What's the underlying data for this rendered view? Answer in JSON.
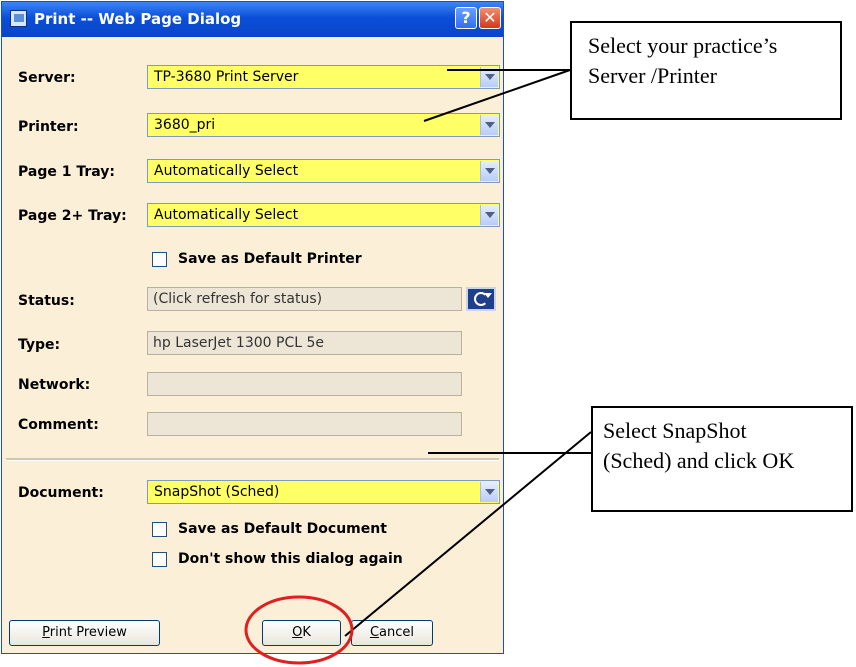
{
  "dialog": {
    "title": "Print -- Web Page Dialog",
    "help_label": "?",
    "close_label": "✕",
    "server": {
      "label": "Server:",
      "value": "TP-3680 Print Server"
    },
    "printer": {
      "label": "Printer:",
      "value": "3680_pri"
    },
    "page1_tray": {
      "label": "Page 1 Tray:",
      "value": "Automatically Select"
    },
    "page2_tray": {
      "label": "Page 2+ Tray:",
      "value": "Automatically Select"
    },
    "save_default_printer": {
      "label": "Save as Default Printer",
      "checked": false
    },
    "status": {
      "label": "Status:",
      "value": "(Click refresh for status)"
    },
    "type": {
      "label": "Type:",
      "value": "hp LaserJet 1300 PCL 5e"
    },
    "network": {
      "label": "Network:",
      "value": ""
    },
    "comment": {
      "label": "Comment:",
      "value": ""
    },
    "document": {
      "label": "Document:",
      "value": "SnapShot (Sched)"
    },
    "save_default_document": {
      "label": "Save as Default Document",
      "checked": false
    },
    "dont_show_again": {
      "label": "Don't show this dialog again",
      "checked": false
    },
    "buttons": {
      "print_preview": {
        "prefix": "",
        "mnemonic": "P",
        "rest": "rint Preview"
      },
      "ok": {
        "prefix": "",
        "mnemonic": "O",
        "rest": "K"
      },
      "cancel": {
        "prefix": "",
        "mnemonic": "C",
        "rest": "ancel"
      }
    }
  },
  "callouts": {
    "server_printer": "Select your practice’s\nServer /Printer",
    "snapshot": "Select SnapShot\n(Sched) and click OK"
  },
  "colors": {
    "title_bar": "#0a4ed8",
    "dialog_bg": "#fbefd8",
    "select_highlight": "#ffff66",
    "annotation_circle": "#e02020"
  },
  "icons": [
    "print-dialog-icon",
    "help-icon",
    "close-icon",
    "refresh-icon",
    "dropdown-arrow-icon",
    "checkbox-icon"
  ]
}
